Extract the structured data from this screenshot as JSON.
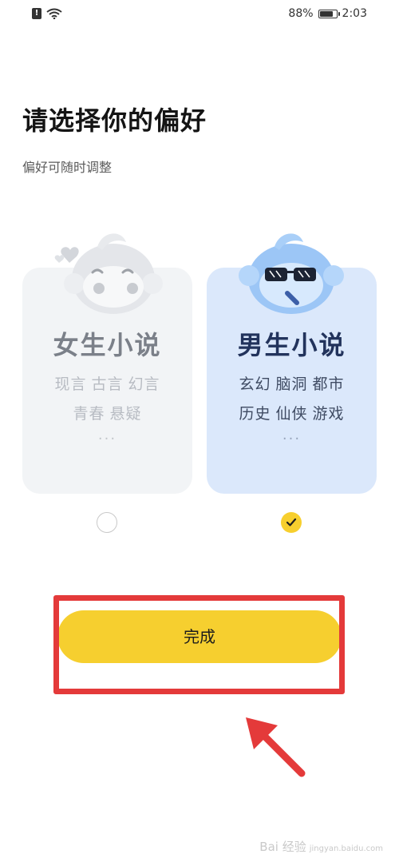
{
  "status_bar": {
    "alert_icon": "alert-sim-icon",
    "wifi_icon": "wifi-icon",
    "battery_percent": "88%",
    "battery_level": 0.88,
    "time": "2:03"
  },
  "page": {
    "title": "请选择你的偏好",
    "subtitle": "偏好可随时调整"
  },
  "options": [
    {
      "title": "女生小说",
      "tags_row1": [
        "现言",
        "古言",
        "幻言"
      ],
      "tags_row2": [
        "青春",
        "悬疑"
      ],
      "ellipsis": "···",
      "selected": false
    },
    {
      "title": "男生小说",
      "tags_row1": [
        "玄幻",
        "脑洞",
        "都市"
      ],
      "tags_row2": [
        "历史",
        "仙侠",
        "游戏"
      ],
      "ellipsis": "···",
      "selected": true
    }
  ],
  "done_button_label": "完成",
  "watermark": {
    "text": "Bai 经验",
    "small": "jingyan.baidu.com"
  },
  "colors": {
    "accent_yellow": "#f6cf2f",
    "annotation_red": "#e43a3a",
    "female_card_bg": "#f2f4f6",
    "male_card_bg": "#dbe8fb"
  }
}
